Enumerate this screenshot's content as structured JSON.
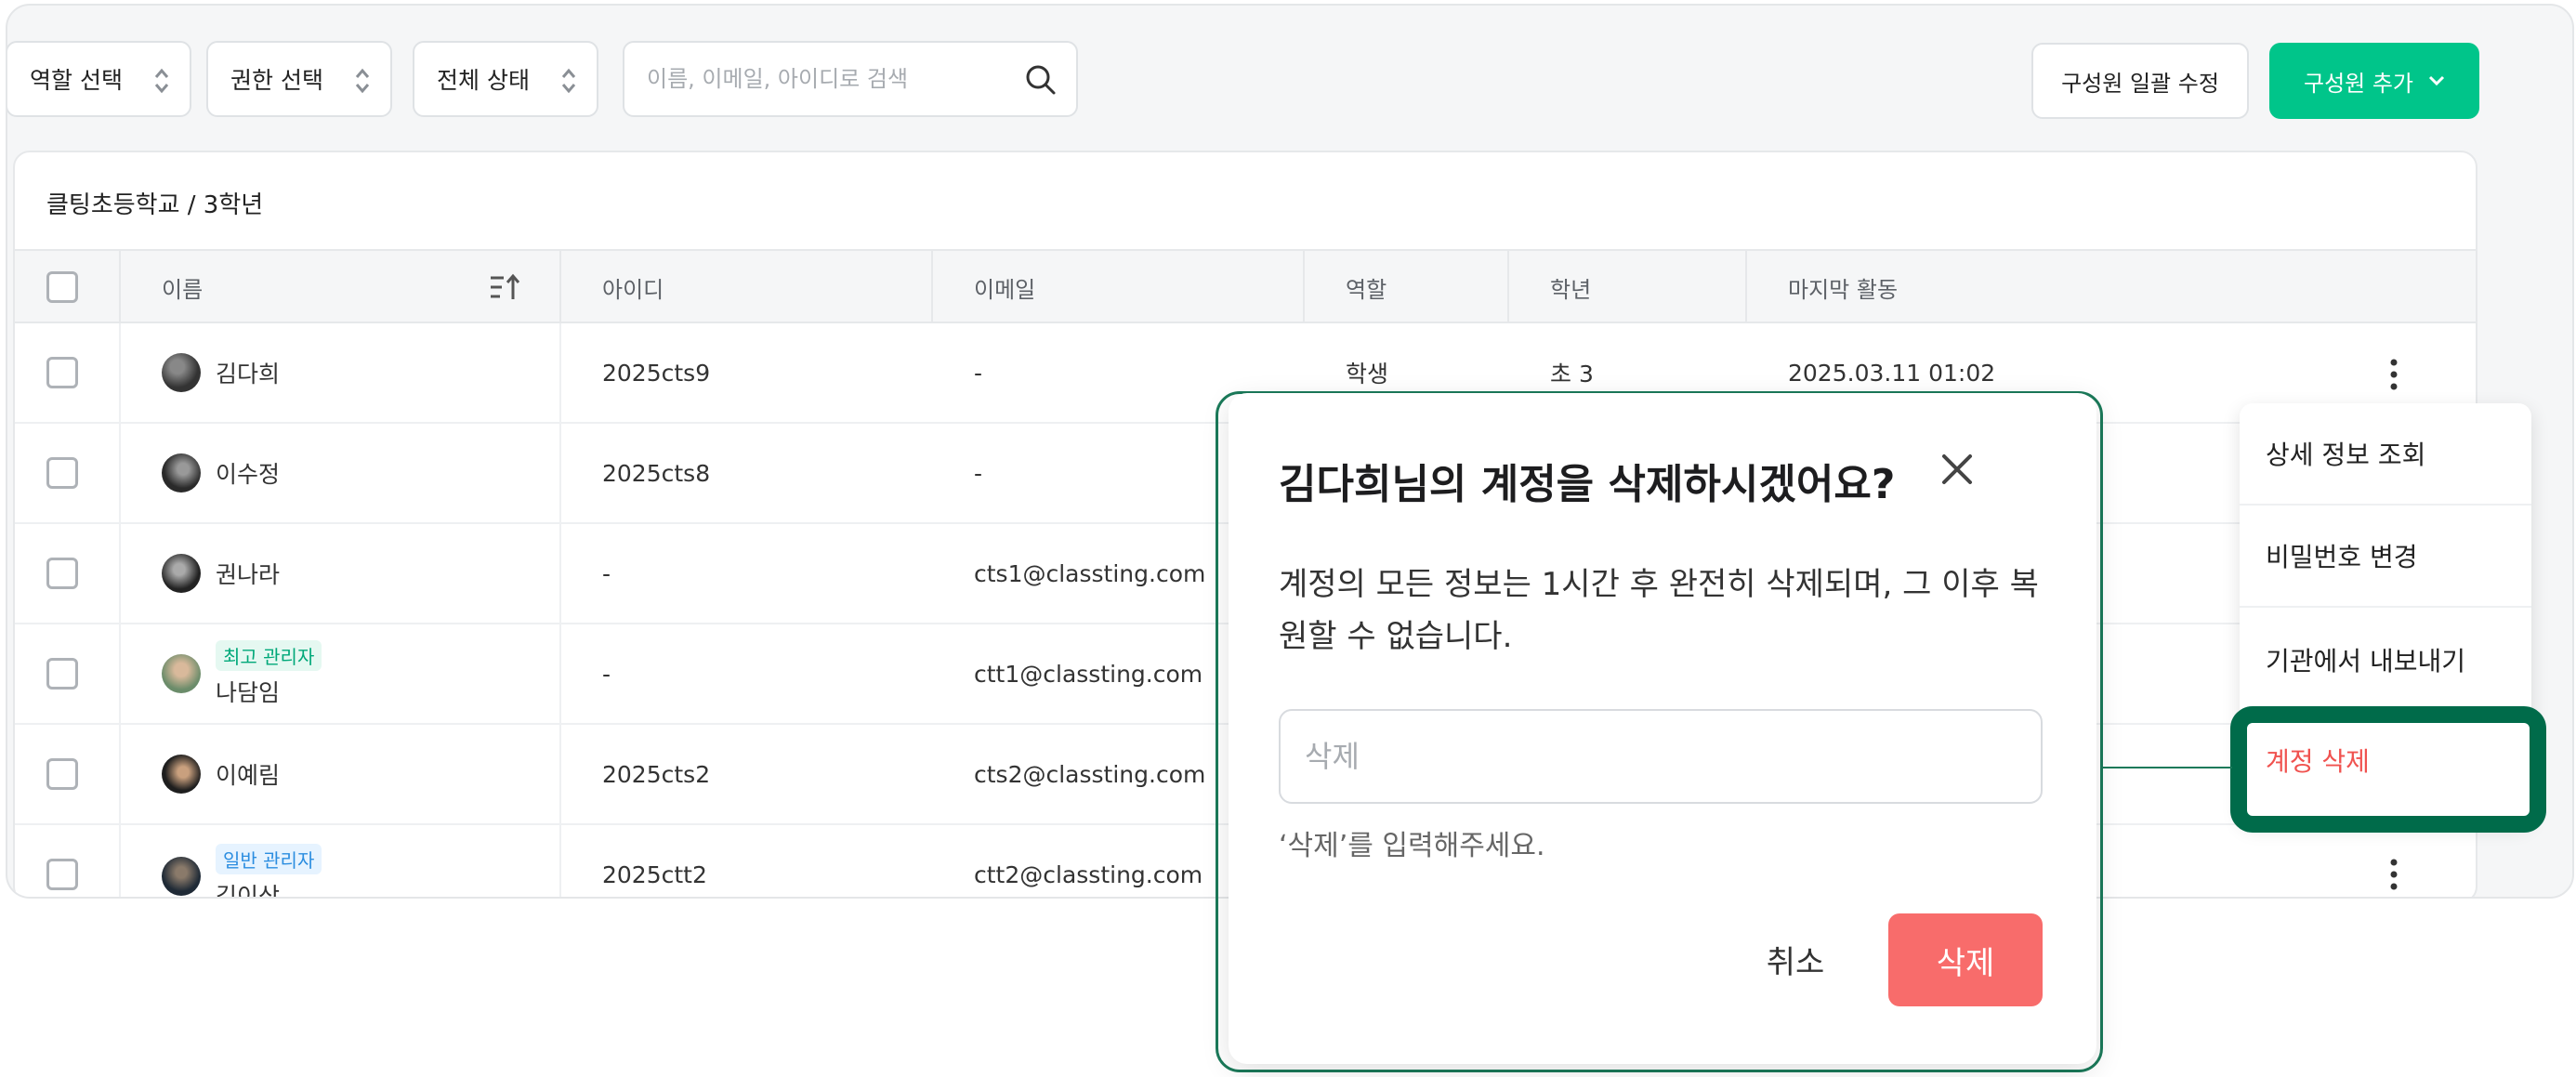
{
  "filters": [
    {
      "label": "역할 선택"
    },
    {
      "label": "권한 선택"
    },
    {
      "label": "전체 상태"
    }
  ],
  "search": {
    "placeholder": "이름, 이메일, 아이디로 검색"
  },
  "toolbar": {
    "bulk_edit_label": "구성원 일괄 수정",
    "add_member_label": "구성원 추가"
  },
  "breadcrumb": "클팅초등학교 / 3학년",
  "table": {
    "columns": [
      "이름",
      "아이디",
      "이메일",
      "역할",
      "학년",
      "마지막 활동"
    ],
    "rows": [
      {
        "name": "김다희",
        "badge": "",
        "id": "2025cts9",
        "email": "-",
        "role": "학생",
        "grade": "초 3",
        "last_active": "2025.03.11 01:02"
      },
      {
        "name": "이수정",
        "badge": "",
        "id": "2025cts8",
        "email": "-",
        "role": "",
        "grade": "",
        "last_active": ""
      },
      {
        "name": "권나라",
        "badge": "",
        "id": "-",
        "email": "cts1@classting.com",
        "role": "",
        "grade": "",
        "last_active": ""
      },
      {
        "name": "나담임",
        "badge": "최고 관리자",
        "id": "-",
        "email": "ctt1@classting.com",
        "role": "",
        "grade": "",
        "last_active": ""
      },
      {
        "name": "이예림",
        "badge": "",
        "id": "2025cts2",
        "email": "cts2@classting.com",
        "role": "",
        "grade": "",
        "last_active": ""
      },
      {
        "name": "김이상",
        "badge": "일반 관리자",
        "id": "2025ctt2",
        "email": "ctt2@classting.com",
        "role": "",
        "grade": "",
        "last_active": ""
      }
    ]
  },
  "dropdown": {
    "items": [
      "상세 정보 조회",
      "비밀번호 변경",
      "기관에서 내보내기",
      "계정 삭제"
    ]
  },
  "modal": {
    "title": "김다희님의 계정을 삭제하시겠어요?",
    "description": "계정의 모든 정보는 1시간 후 완전히 삭제되며, 그 이후 복원할 수 없습니다.",
    "input_placeholder": "삭제",
    "hint": "‘삭제’를 입력해주세요.",
    "cancel_label": "취소",
    "confirm_label": "삭제"
  },
  "colors": {
    "accent": "#00c58a",
    "danger": "#f86c6b",
    "danger_text": "#f0524f",
    "highlight": "#006b4a"
  }
}
